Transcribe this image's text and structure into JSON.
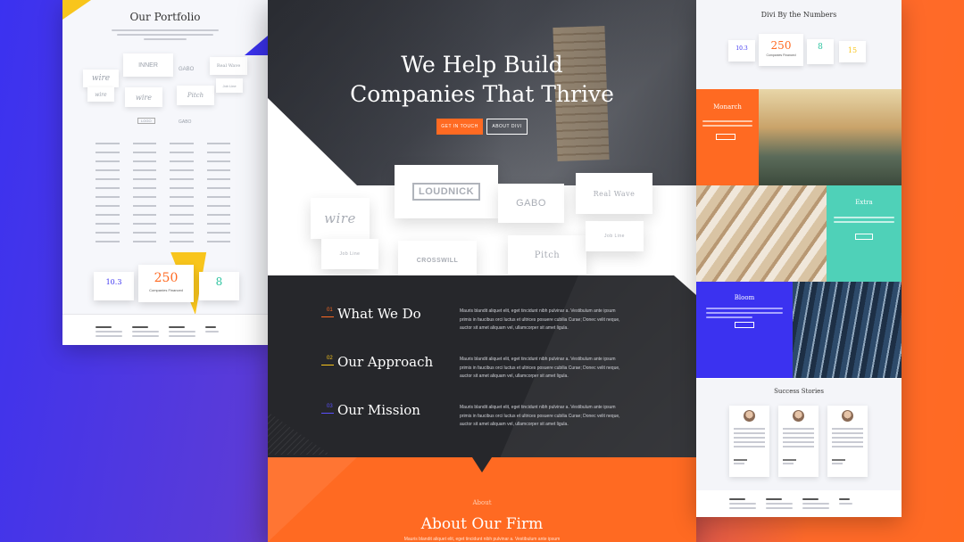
{
  "left_page": {
    "portfolio_title": "Our Portfolio",
    "logos": [
      "wire",
      "INNER",
      "GABO",
      "Real Wave",
      "wire",
      "wire",
      "Pitch",
      "Job Line",
      "LOGO",
      "GABO"
    ],
    "stats": [
      {
        "value": "10.3",
        "color": "#3b32f0"
      },
      {
        "value": "250",
        "label": "Companies Financed",
        "color": "#ff6a22"
      },
      {
        "value": "8",
        "color": "#2fc4a0"
      }
    ]
  },
  "center_page": {
    "hero_title_line1": "We Help Build",
    "hero_title_line2": "Companies That Thrive",
    "btn_get_in_touch": "GET IN TOUCH",
    "btn_about_divi": "ABOUT DIVI",
    "client_logos": [
      "wire",
      "LOUDNICK",
      "GABO",
      "Real Wave",
      "Job Line",
      "CROSSWILL",
      "Pitch",
      "Job Line"
    ],
    "sections": [
      {
        "num": "01",
        "num_color": "#ff6a22",
        "title": "What We Do",
        "text": [
          "Mauris blandit aliquet elit, eget tincidunt nibh pulvinar a. Vestibulum ante ipsum",
          "primis in faucibus orci luctus et ultrices posuere cubilia Curae; Donec velit neque,",
          "auctor sit amet aliquam vel, ullamcorper sit amet ligula."
        ]
      },
      {
        "num": "02",
        "num_color": "#f8c51c",
        "title": "Our Approach",
        "text": [
          "Mauris blandit aliquet elit, eget tincidunt nibh pulvinar a. Vestibulum ante ipsum",
          "primis in faucibus orci luctus et ultrices posuere cubilia Curae; Donec velit neque,",
          "auctor sit amet aliquam vel, ullamcorper sit amet ligula."
        ]
      },
      {
        "num": "03",
        "num_color": "#5a50ff",
        "title": "Our Mission",
        "text": [
          "Mauris blandit aliquet elit, eget tincidunt nibh pulvinar a. Vestibulum ante ipsum",
          "primis in faucibus orci luctus et ultrices posuere cubilia Curae; Donec velit neque,",
          "auctor sit amet aliquam vel, ullamcorper sit amet ligula."
        ]
      }
    ],
    "about_label": "About",
    "about_title": "About Our Firm",
    "about_text": "Mauris blandit aliquet elit, eget tincidunt nibh pulvinar a. Vestibulum ante ipsum"
  },
  "right_page": {
    "numbers_title": "Divi By the Numbers",
    "stats": [
      {
        "value": "10.3",
        "color": "#3b32f0"
      },
      {
        "value": "250",
        "label": "Companies Financed",
        "color": "#ff6a22"
      },
      {
        "value": "8",
        "color": "#2fc4a0"
      },
      {
        "value": "15",
        "color": "#f8c51c"
      }
    ],
    "tiles": [
      {
        "name": "Monarch",
        "color": "#ff6a22"
      },
      {
        "name": "Extra",
        "color": "#4fd1b8"
      },
      {
        "name": "Bloom",
        "color": "#3b32f0"
      }
    ],
    "success_title": "Success Stories"
  },
  "colors": {
    "orange": "#ff6a22",
    "dark": "#26272b",
    "blue": "#3b32f0",
    "yellow": "#f8c51c",
    "teal": "#4fd1b8"
  }
}
